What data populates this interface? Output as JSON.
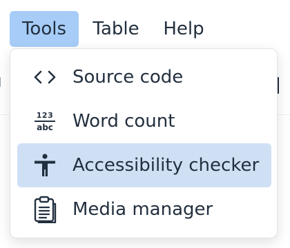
{
  "menubar": {
    "items": [
      {
        "label": "Tools",
        "active": true
      },
      {
        "label": "Table",
        "active": false
      },
      {
        "label": "Help",
        "active": false
      }
    ]
  },
  "menu": {
    "items": [
      {
        "label": "Source code",
        "icon": "source-code-icon",
        "highlighted": false
      },
      {
        "label": "Word count",
        "icon": "word-count-icon",
        "icon_text_top": "123",
        "icon_text_bottom": "abc",
        "highlighted": false
      },
      {
        "label": "Accessibility checker",
        "icon": "accessibility-icon",
        "highlighted": true
      },
      {
        "label": "Media manager",
        "icon": "clipboard-icon",
        "highlighted": false
      }
    ]
  },
  "colors": {
    "active_menubar_bg": "#a6ccf7",
    "highlight_item_bg": "#cfe0f5",
    "text": "#222f3e"
  }
}
